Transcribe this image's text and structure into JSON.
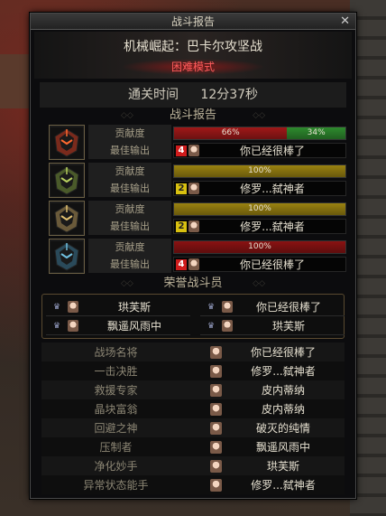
{
  "window": {
    "title": "战斗报告",
    "close_glyph": "✕"
  },
  "dungeon": {
    "name": "机械崛起：巴卡尔攻坚战",
    "difficulty": "困难模式"
  },
  "clear": {
    "label": "通关时间",
    "time": "12分37秒"
  },
  "battle_report": {
    "title": "战斗报告",
    "contribution_label": "贡献度",
    "best_output_label": "最佳输出",
    "players": [
      {
        "portrait": "red-helmet-portrait",
        "bar_color": "#a01818",
        "bar2_color": "#2e8b2e",
        "share": 66,
        "share_label": "66%",
        "share2": 34,
        "share2_label": "34%",
        "rank": "4",
        "rank_color": "#d01c1c",
        "best_name": "你已经很棒了"
      },
      {
        "portrait": "green-helmet-portrait",
        "bar_color": "#9a8210",
        "share": 100,
        "share_label": "100%",
        "rank": "2",
        "rank_color": "#d8c010",
        "best_name": "修罗...弑神者"
      },
      {
        "portrait": "gold-helmet-portrait",
        "bar_color": "#9a8210",
        "share": 100,
        "share_label": "100%",
        "rank": "2",
        "rank_color": "#d8c010",
        "best_name": "修罗...弑神者"
      },
      {
        "portrait": "blue-helmet-portrait",
        "bar_color": "#8a1212",
        "share": 100,
        "share_label": "100%",
        "rank": "4",
        "rank_color": "#d01c1c",
        "best_name": "你已经很棒了"
      }
    ]
  },
  "honor": {
    "title": "荣誉战斗员",
    "members": [
      "珙芙斯",
      "你已经很棒了",
      "飘遥风雨中",
      "珙芙斯"
    ]
  },
  "awards": [
    {
      "title": "战场名将",
      "player": "你已经很棒了"
    },
    {
      "title": "一击决胜",
      "player": "修罗...弑神者"
    },
    {
      "title": "救援专家",
      "player": "皮内蒂纳"
    },
    {
      "title": "晶块富翁",
      "player": "皮内蒂纳"
    },
    {
      "title": "回避之神",
      "player": "破灭的纯情"
    },
    {
      "title": "压制者",
      "player": "飘遥风雨中"
    },
    {
      "title": "净化妙手",
      "player": "珙芙斯"
    },
    {
      "title": "异常状态能手",
      "player": "修罗...弑神者"
    }
  ]
}
